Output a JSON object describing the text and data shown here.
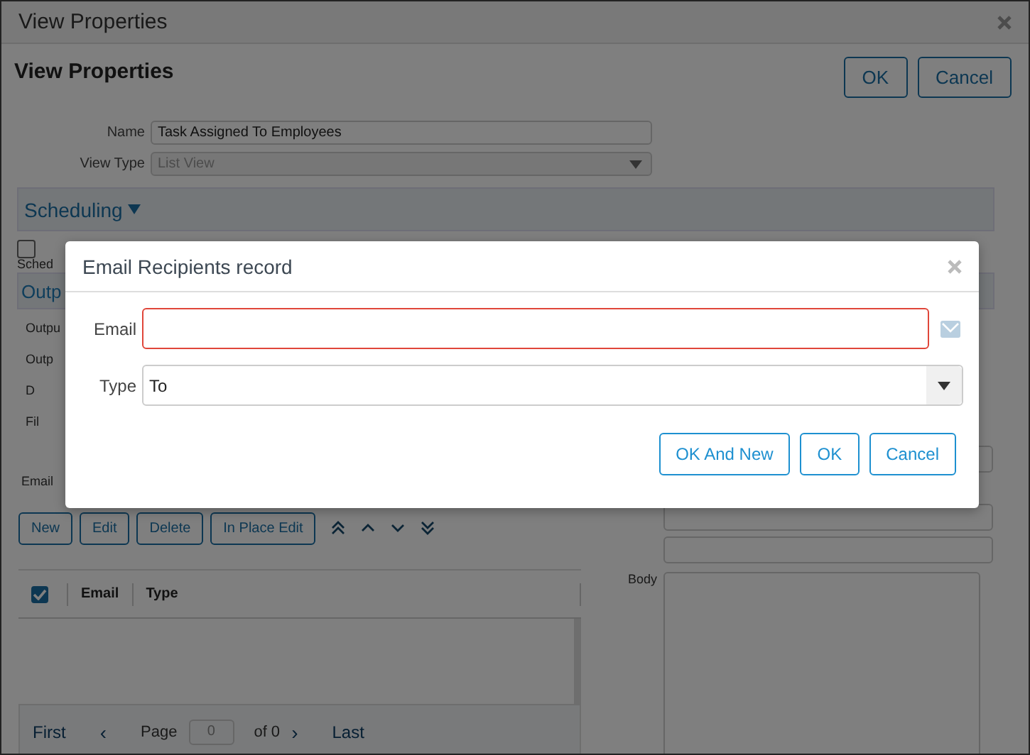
{
  "window": {
    "title": "View Properties"
  },
  "header": {
    "title": "View Properties",
    "buttons": [
      "OK",
      "Cancel"
    ]
  },
  "fields": [
    {
      "label": "Name",
      "value": "Task Assigned To Employees",
      "kind": "text",
      "disabled": false
    },
    {
      "label": "View Type",
      "value": "List View",
      "kind": "select",
      "disabled": true
    }
  ],
  "scheduling": {
    "title": "Scheduling",
    "expanded": true,
    "checked": false,
    "checkbox_label": "Sched"
  },
  "output": {
    "title": "Outp",
    "labels": [
      "Outpu",
      "Outp",
      "D",
      "Fil",
      "Email"
    ],
    "toolbar": [
      "New",
      "Edit",
      "Delete",
      "In Place Edit"
    ],
    "body_label": "Body"
  },
  "grid": {
    "select_all_checked": true,
    "columns": [
      "Email",
      "Type"
    ],
    "pager": {
      "first": "First",
      "prev": "‹",
      "page_label": "Page",
      "page": "0",
      "of": "of 0",
      "next": "›",
      "last": "Last"
    }
  },
  "dialog": {
    "title": "Email Recipients record",
    "fields": [
      {
        "label": "Email",
        "kind": "email",
        "invalid": true
      },
      {
        "label": "Type",
        "value": "To",
        "kind": "select",
        "invalid": false
      }
    ],
    "buttons": [
      "OK And New",
      "OK",
      "Cancel"
    ]
  }
}
